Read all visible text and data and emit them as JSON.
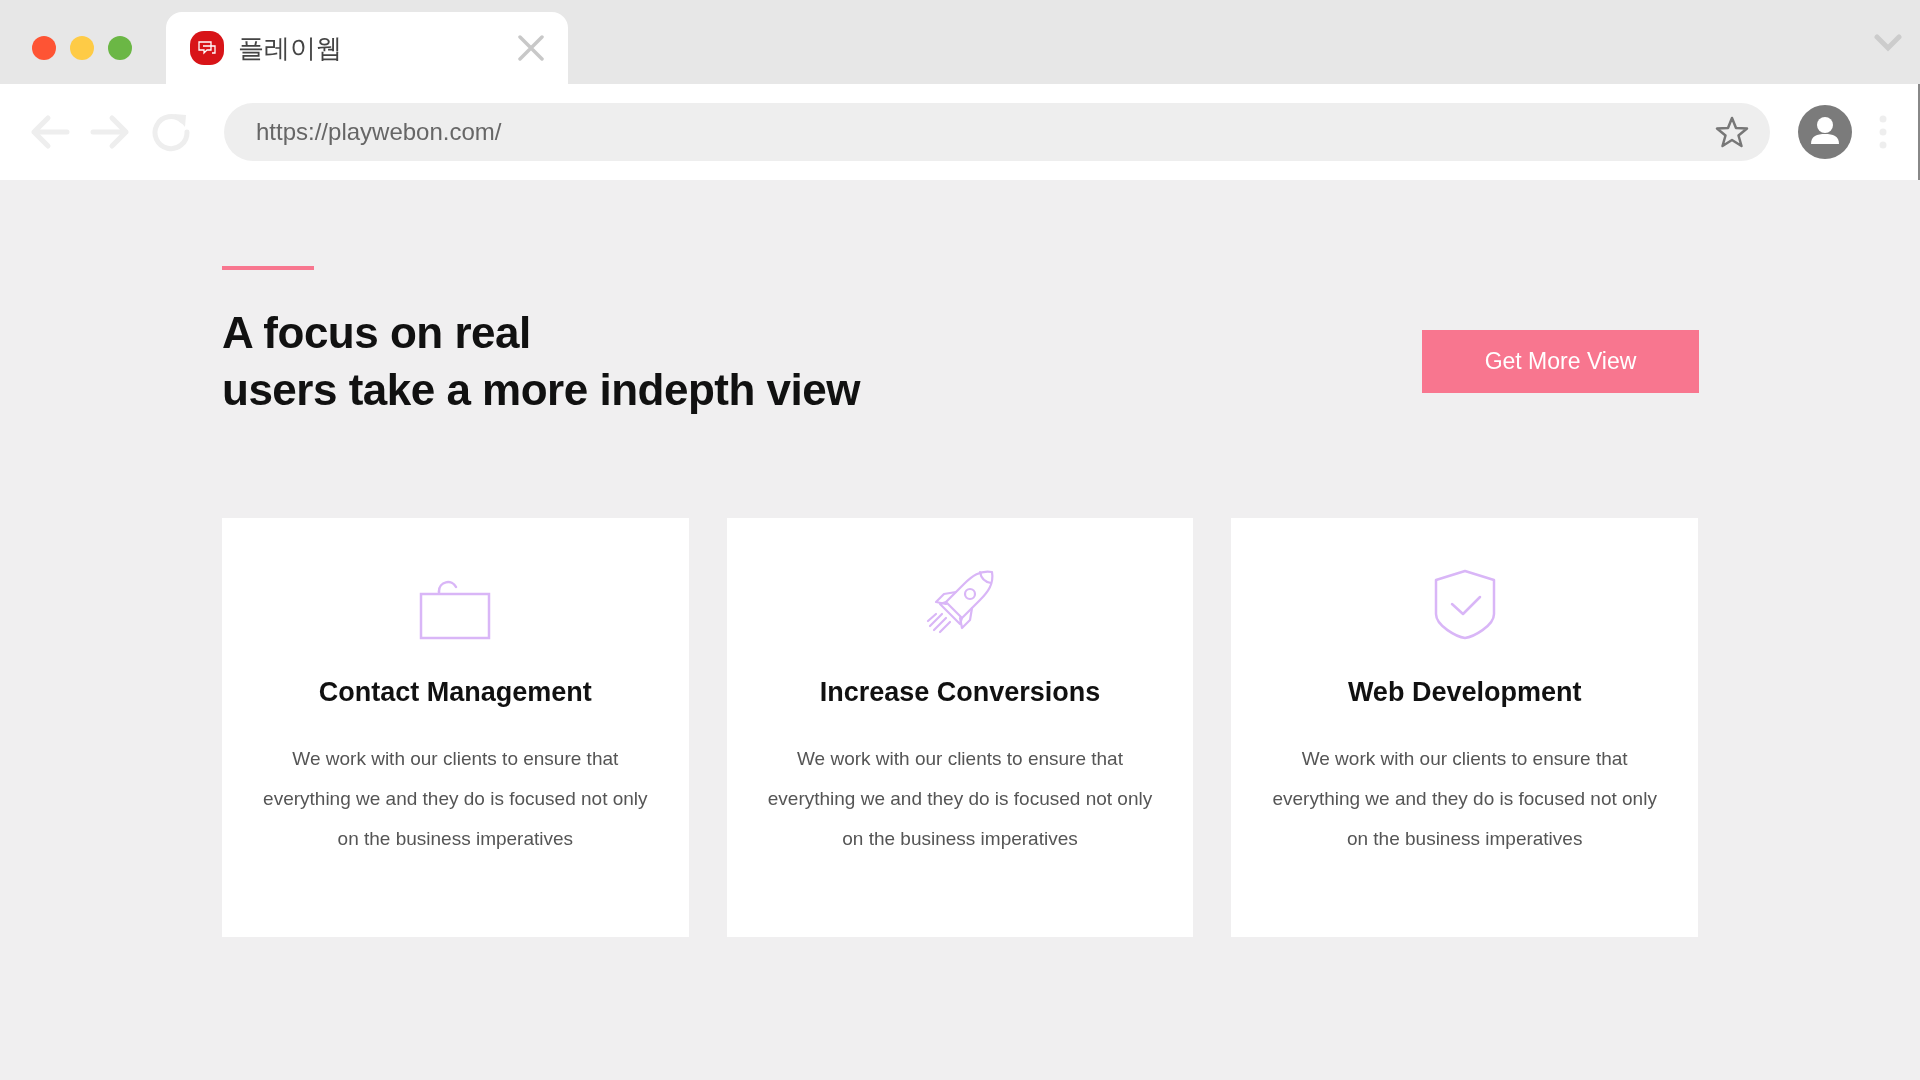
{
  "browser": {
    "tab": {
      "title": "플레이웹"
    },
    "url": "https://playwebon.com/"
  },
  "hero": {
    "title_lines": [
      "A focus on real",
      "users take a more indepth view"
    ],
    "button": "Get More View"
  },
  "cards": [
    {
      "kind": "bag",
      "title": "Contact Management",
      "lines": [
        "We work with our clients to ensure that",
        "everything we and they do is focused not only",
        "on the business imperatives"
      ]
    },
    {
      "kind": "rocket",
      "title": "Increase Conversions",
      "lines": [
        "We work with our clients to ensure that",
        "everything we and they do is focused not only",
        "on the business imperatives"
      ]
    },
    {
      "kind": "shield",
      "title": "Web Development",
      "lines": [
        "We work with our clients to ensure that",
        "everything we and they do is focused not only",
        "on the business imperatives"
      ]
    }
  ]
}
